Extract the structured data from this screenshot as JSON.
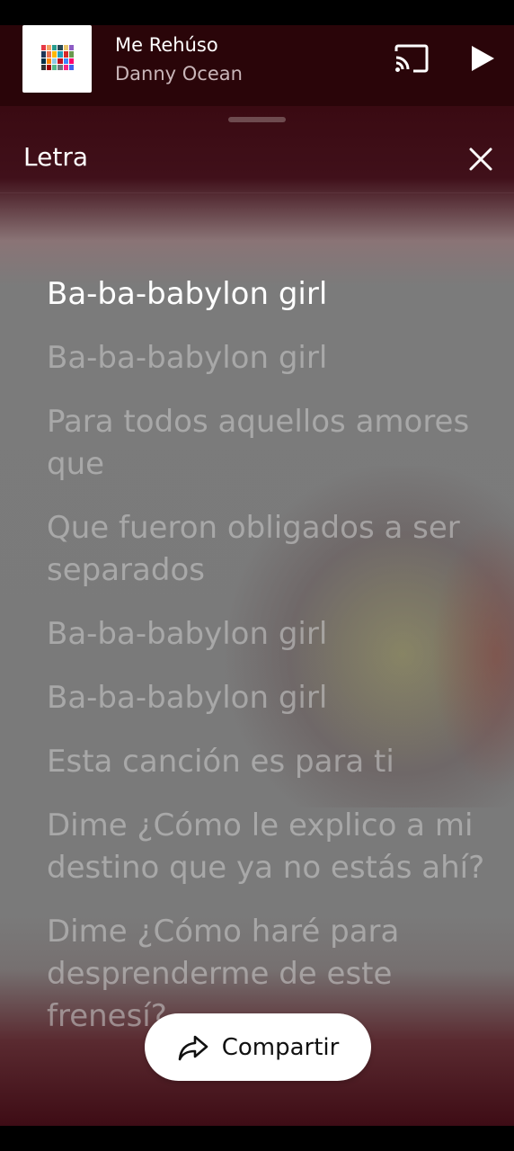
{
  "player": {
    "title": "Me Rehúso",
    "artist": "Danny Ocean",
    "cast_icon": "cast-icon",
    "play_icon": "play-icon"
  },
  "sheet": {
    "title": "Letra",
    "close_icon": "close-icon"
  },
  "lyrics": [
    "Ba-ba-babylon girl",
    "Ba-ba-babylon girl",
    "Para todos aquellos amores que",
    "Que fueron obligados a ser separados",
    "Ba-ba-babylon girl",
    "Ba-ba-babylon girl",
    "Esta canción es para ti",
    "Dime ¿Cómo le explico a mi destino que ya no estás ahí?",
    "Dime ¿Cómo haré para desprenderme de este frenesí?"
  ],
  "active_line": 0,
  "share": {
    "label": "Compartir",
    "icon": "share-icon"
  },
  "colors": {
    "accent_dark": "#2a0509",
    "sheet_top": "#3a0a12",
    "lyric_active": "#ffffff",
    "lyric_inactive": "#cdcdcd"
  }
}
